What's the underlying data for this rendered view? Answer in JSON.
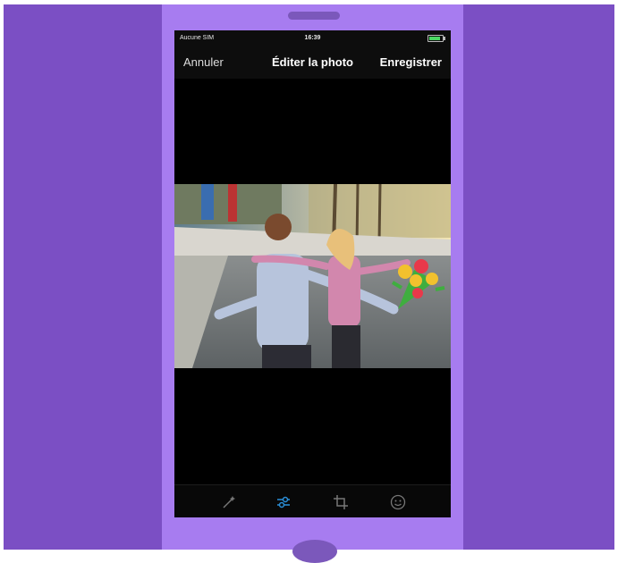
{
  "status_bar": {
    "carrier": "Aucune SIM",
    "time": "16:39"
  },
  "nav_bar": {
    "cancel_label": "Annuler",
    "title": "Éditer la photo",
    "save_label": "Enregistrer"
  },
  "toolbar": {
    "items": [
      {
        "icon": "magic-wand-icon",
        "active": false
      },
      {
        "icon": "adjust-sliders-icon",
        "active": true
      },
      {
        "icon": "crop-icon",
        "active": false
      },
      {
        "icon": "sticker-smiley-icon",
        "active": false
      }
    ]
  },
  "colors": {
    "background": "#7b4fc4",
    "phone_frame": "#a77cf0",
    "active_tool": "#2b8fd8",
    "inactive_tool": "#777777"
  }
}
